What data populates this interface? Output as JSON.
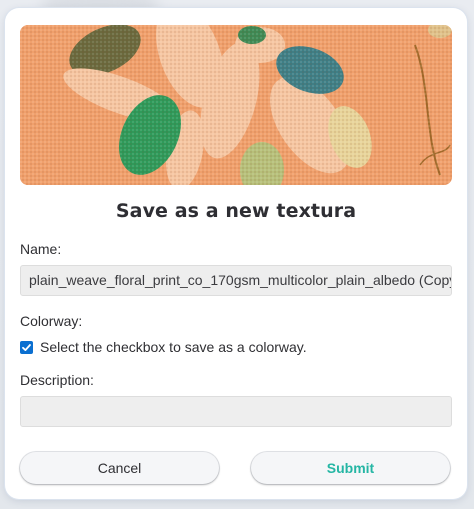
{
  "dialog": {
    "title": "Save as a new textura",
    "hero_image": {
      "icon": "fabric-texture-preview",
      "description_colors": {
        "base": "#f0a06c",
        "petal": "#f6c6a2",
        "leaf_green": "#2f9a5a",
        "leaf_teal": "#3f7f86",
        "leaf_olive": "#6b6a3e",
        "leaf_yellow": "#e8d49a"
      }
    }
  },
  "form": {
    "name_label": "Name:",
    "name_value": "plain_weave_floral_print_co_170gsm_multicolor_plain_albedo (Copy)",
    "colorway_label": "Colorway:",
    "colorway_checkbox_label": "Select the checkbox to save as a colorway.",
    "colorway_checked": true,
    "description_label": "Description:",
    "description_value": "",
    "description_placeholder": ""
  },
  "actions": {
    "cancel_label": "Cancel",
    "submit_label": "Submit"
  },
  "colors": {
    "accent": "#25b6a4",
    "checkbox": "#0b6fd0",
    "field_bg": "#eeeeee"
  }
}
